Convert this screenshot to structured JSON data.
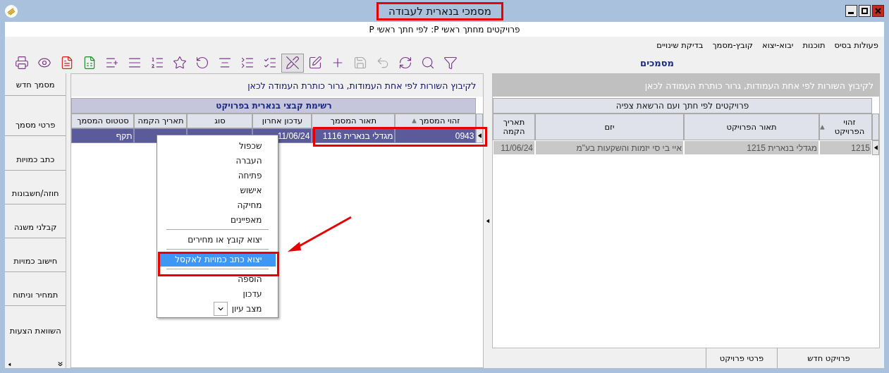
{
  "window": {
    "title": "מסמכי בנארית לעבודה",
    "subtitle": "פרויקטים מחתך ראשי P: לפי חתך ראשי P"
  },
  "menu_bar": [
    "פעולות בסיס",
    "תוכנות",
    "יבוא-יצוא",
    "קובץ-מסמך",
    "בדיקת שינויים"
  ],
  "toolbar_buttons": [
    {
      "selected": false
    },
    {
      "selected": false
    },
    {
      "selected": false
    },
    {
      "selected": false
    },
    {
      "selected": false
    },
    {
      "selected": false
    },
    {
      "selected": false
    },
    {
      "selected": false
    },
    {
      "selected": false
    },
    {
      "selected": false
    },
    {
      "selected": false
    },
    {
      "selected": false
    },
    {
      "selected": true
    },
    {
      "selected": false
    },
    {
      "selected": false
    },
    {
      "selected": false
    },
    {
      "selected": false
    },
    {
      "selected": false
    },
    {
      "selected": false
    },
    {
      "selected": false
    }
  ],
  "section_label": "מסמכים",
  "sidebar": [
    "מסמך חדש",
    "פרטי מסמך",
    "כתב כמויות",
    "חוזה/חשבונות",
    "קבלני משנה",
    "חישוב כמויות",
    "תמחיר וניתוח",
    "השוואת הצעות"
  ],
  "documents_panel": {
    "group_hint": "לקיבוץ השורות לפי אחת העמודות, גרור כותרת העמודה לכאן",
    "title": "רשימת קבצי בנארית בפרויקט",
    "columns": [
      {
        "label": "זהוי המסמך",
        "sorted": true
      },
      {
        "label": "תאור המסמך",
        "sorted": false
      },
      {
        "label": "עדכון אחרון",
        "sorted": false
      },
      {
        "label": "סוג",
        "sorted": false
      },
      {
        "label": "תאריך הקמה",
        "sorted": false
      },
      {
        "label": "סטטוס המסמך",
        "sorted": false
      }
    ],
    "rows": [
      {
        "selected": true,
        "cells": [
          "0943",
          "מגדלי בנארית 1116",
          "11/06/24",
          null,
          null,
          "תקף"
        ]
      }
    ]
  },
  "context_menu": [
    {
      "kind": "item",
      "label": "שכפול",
      "selected": false
    },
    {
      "kind": "item",
      "label": "העברה",
      "selected": false
    },
    {
      "kind": "item",
      "label": "פתיחה",
      "selected": false
    },
    {
      "kind": "item",
      "label": "אישוש",
      "selected": false
    },
    {
      "kind": "item",
      "label": "מחיקה",
      "selected": false
    },
    {
      "kind": "item",
      "label": "מאפיינים",
      "selected": false
    },
    {
      "kind": "separator"
    },
    {
      "kind": "item",
      "label": "יצוא קובץ או מחירים",
      "selected": false
    },
    {
      "kind": "separator"
    },
    {
      "kind": "item",
      "label": "יצוא כתב כמויות לאקסל",
      "selected": true
    },
    {
      "kind": "separator"
    },
    {
      "kind": "item",
      "label": "הוספה",
      "selected": false
    },
    {
      "kind": "item",
      "label": "עדכון",
      "selected": false
    },
    {
      "kind": "dropdown",
      "label": "מצב עיון",
      "selected": false
    }
  ],
  "projects_panel": {
    "group_hint": "לקיבוץ השורות לפי אחת העמודות, גרור כותרת העמודה לכאן",
    "title": "פרויקטים לפי חתך ועם הרשאת צפיה",
    "columns": [
      {
        "label": "זהוי הפרויקט",
        "sorted": true
      },
      {
        "label": "תאור הפרויקט",
        "sorted": false
      },
      {
        "label": "יזם",
        "sorted": false
      },
      {
        "label": "תאריך הקמה",
        "sorted": false
      }
    ],
    "rows": [
      {
        "selected": false,
        "cells": [
          "1215",
          "מגדלי בנארית 1215",
          "איי בי סי יזמות והשקעות בע\"מ",
          "11/06/24"
        ]
      }
    ],
    "buttons": [
      "פרויקט חדש",
      "פרטי פרויקט"
    ]
  }
}
